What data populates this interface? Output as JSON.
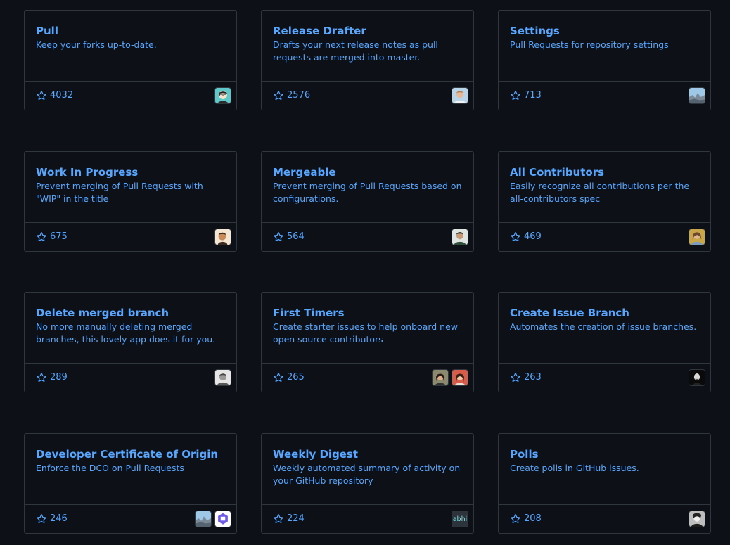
{
  "cards": [
    {
      "title": "Pull",
      "description": "Keep your forks up-to-date.",
      "stars": "4032",
      "avatars": [
        "cartoon-avatar-icon"
      ]
    },
    {
      "title": "Release Drafter",
      "description": "Drafts your next release notes as pull requests are merged into master.",
      "stars": "2576",
      "avatars": [
        "person-avatar-icon"
      ]
    },
    {
      "title": "Settings",
      "description": "Pull Requests for repository settings",
      "stars": "713",
      "avatars": [
        "landscape-avatar-icon"
      ]
    },
    {
      "title": "Work In Progress",
      "description": "Prevent merging of Pull Requests with \"WIP\" in the title",
      "stars": "675",
      "avatars": [
        "person-avatar-icon"
      ]
    },
    {
      "title": "Mergeable",
      "description": "Prevent merging of Pull Requests based on configurations.",
      "stars": "564",
      "avatars": [
        "person-avatar-icon"
      ]
    },
    {
      "title": "All Contributors",
      "description": "Easily recognize all contributions per the all-contributors spec",
      "stars": "469",
      "avatars": [
        "person-avatar-icon"
      ]
    },
    {
      "title": "Delete merged branch",
      "description": "No more manually deleting merged branches, this lovely app does it for you.",
      "stars": "289",
      "avatars": [
        "person-avatar-icon"
      ]
    },
    {
      "title": "First Timers",
      "description": "Create starter issues to help onboard new open source contributors",
      "stars": "265",
      "avatars": [
        "person-avatar-icon",
        "person-avatar-icon"
      ]
    },
    {
      "title": "Create Issue Branch",
      "description": "Automates the creation of issue branches.",
      "stars": "263",
      "avatars": [
        "person-avatar-icon"
      ]
    },
    {
      "title": "Developer Certificate of Origin",
      "description": "Enforce the DCO on Pull Requests",
      "stars": "246",
      "avatars": [
        "landscape-avatar-icon",
        "logo-avatar-icon"
      ]
    },
    {
      "title": "Weekly Digest",
      "description": "Weekly automated summary of activity on your GitHub repository",
      "stars": "224",
      "avatars": [
        "abhi"
      ]
    },
    {
      "title": "Polls",
      "description": "Create polls in GitHub issues.",
      "stars": "208",
      "avatars": [
        "person-avatar-icon"
      ]
    }
  ],
  "colors": {
    "background": "#0d1117",
    "border": "#30363d",
    "link": "#58a6ff"
  }
}
